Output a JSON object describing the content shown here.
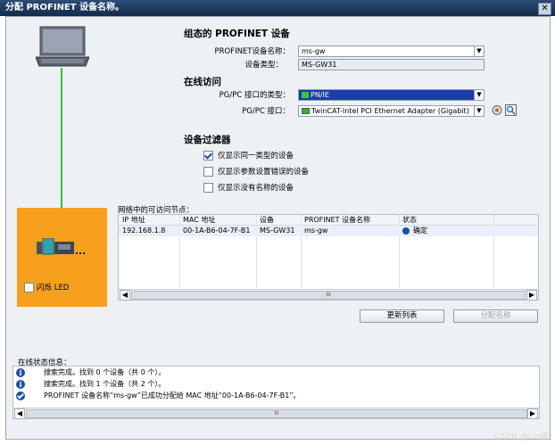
{
  "window": {
    "title": "分配 PROFINET 设备名称。",
    "close": "✕"
  },
  "configured": {
    "heading": "组态的 PROFINET 设备",
    "name_label": "PROFINET设备名称：",
    "name_value": "ms-gw",
    "type_label": "设备类型：",
    "type_value": "MS-GW31"
  },
  "online": {
    "heading": "在线访问",
    "iface_type_label": "PG/PC 接口的类型：",
    "iface_type_value": "PN/IE",
    "iface_label": "PG/PC 接口：",
    "iface_value": "TwinCAT-Intel PCI Ethernet Adapter (Gigabit)"
  },
  "filter": {
    "heading": "设备过滤器",
    "options": [
      {
        "label": "仅显示同一类型的设备",
        "checked": true
      },
      {
        "label": "仅显示参数设置错误的设备",
        "checked": false
      },
      {
        "label": "仅显示没有名称的设备",
        "checked": false
      }
    ]
  },
  "flash_led": {
    "label": "闪烁 LED",
    "checked": false
  },
  "nodes": {
    "caption": "网络中的可访问节点：",
    "columns": [
      "IP 地址",
      "MAC 地址",
      "设备",
      "PROFINET 设备名称",
      "状态"
    ],
    "rows": [
      {
        "ip": "192.168.1.8",
        "mac": "00-1A-B6-04-7F-B1",
        "device": "MS-GW31",
        "name": "ms-gw",
        "status": "确定"
      }
    ],
    "scroll_mark": "III"
  },
  "buttons": {
    "refresh": "更新列表",
    "assign": "分配名称"
  },
  "status_info": {
    "caption": "在线状态信息：",
    "messages": [
      {
        "icon": "info",
        "text": "搜索完成。找到 0 个设备（共 0 个）。"
      },
      {
        "icon": "info",
        "text": "搜索完成。找到 1 个设备（共 2 个）。"
      },
      {
        "icon": "ok",
        "text": "PROFINET 设备名称“ms-gw”已成功分配给 MAC 地址“00-1A-B6-04-7F-B1”。"
      }
    ],
    "scroll_mark": "III"
  },
  "watermark": "CSDN @Lin椒",
  "colors": {
    "accent": "#1a3fa8",
    "orange_panel": "#f7a01e",
    "link_line": "#39c039"
  }
}
